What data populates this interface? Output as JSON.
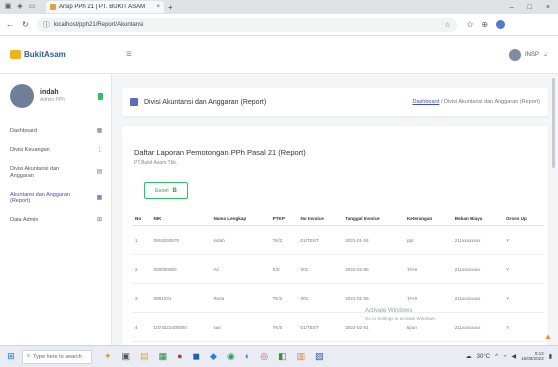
{
  "browser": {
    "tab_title": "Arsip PPh 21 | PT. BUKIT ASAM",
    "url": "localhost/pph21/Report/Akuntansi"
  },
  "app": {
    "brand": "BukitAsam",
    "user_short": "INSP",
    "profile_name": "indah",
    "profile_role": "Admin PPh"
  },
  "sidebar": {
    "items": [
      {
        "label": "Dashboard",
        "icon": "▦"
      },
      {
        "label": "Divisi Keuangan",
        "icon": "⋮"
      },
      {
        "label": "Divisi Akuntansi dan Anggaran",
        "icon": "▤"
      },
      {
        "label": "Akuntansi dan Anggaran (Report)",
        "icon": "▦"
      },
      {
        "label": "Data Admin",
        "icon": "⊞"
      }
    ]
  },
  "page": {
    "title": "Divisi Akuntansi dan Anggaran (Report)",
    "breadcrumb_link": "Dashboard",
    "breadcrumb_current": "/ Divisi Akuntansi dan Anggaran (Report)"
  },
  "card": {
    "title": "Daftar Laporan Pemotongan PPh Pasal 21 (Report)",
    "subtitle": "PT.Bukit Asam Tbk.",
    "excel_label": "Excel"
  },
  "table": {
    "headers": [
      "No",
      "NIK",
      "Nama Lengkap",
      "PTKP",
      "No Invoice",
      "Tanggal Invoice",
      "Keterangan",
      "Beban Biaya",
      "Gross Up"
    ],
    "rows": [
      [
        "1",
        "0919334570",
        "indah",
        "TK/2",
        "01/TEST",
        "2021-01-04",
        "ppt",
        "211xxxxxxxx",
        "Y"
      ],
      [
        "2",
        "000000000",
        "Ari",
        "K/0",
        "001",
        "2022-02-06",
        "TAHI",
        "211xxxxxxxx",
        "Y"
      ],
      [
        "3",
        "0991031",
        "Rosa",
        "TK/2",
        "001",
        "2021-01-06",
        "TAHI",
        "211xxxxxxxx",
        "Y"
      ],
      [
        "4",
        "1074022400000",
        "sari",
        "TK/0",
        "01/TEST",
        "2022-02-01",
        "tipun",
        "211xxxxxxxx",
        "Y"
      ]
    ]
  },
  "watermark": {
    "line1": "Activate Windows",
    "line2": "Go to Settings to activate Windows."
  },
  "taskbar": {
    "search_placeholder": "Type here to search",
    "weather": "30°C",
    "time": "9:13",
    "date": "16/08/2023"
  }
}
